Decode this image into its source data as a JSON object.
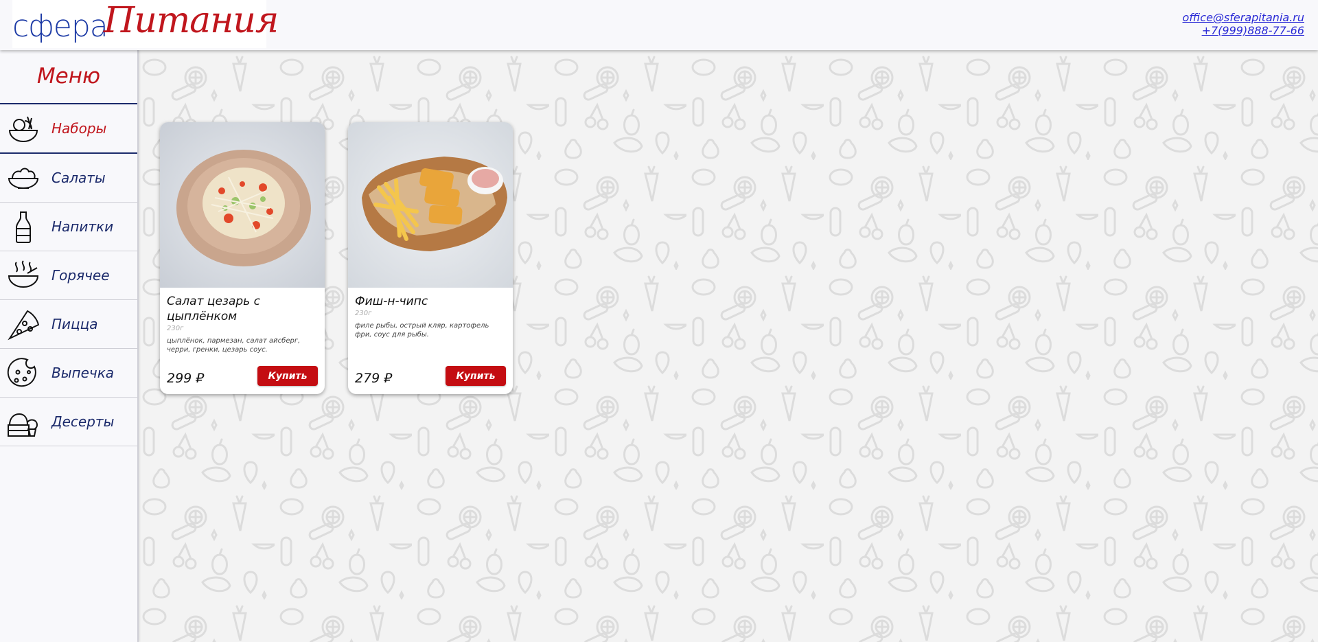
{
  "header": {
    "logo_part1": "сфера",
    "logo_part2": "Питания",
    "email": "office@sferapitania.ru",
    "phone": "+7(999)888-77-66"
  },
  "sidebar": {
    "title": "Меню",
    "items": [
      {
        "label": "Наборы",
        "icon": "food-set-icon",
        "active": true
      },
      {
        "label": "Салаты",
        "icon": "salad-bowl-icon",
        "active": false
      },
      {
        "label": "Напитки",
        "icon": "bottle-icon",
        "active": false
      },
      {
        "label": "Горячее",
        "icon": "hot-bowl-icon",
        "active": false
      },
      {
        "label": "Пицца",
        "icon": "pizza-slice-icon",
        "active": false
      },
      {
        "label": "Выпечка",
        "icon": "cookie-icon",
        "active": false
      },
      {
        "label": "Десерты",
        "icon": "dessert-icon",
        "active": false
      }
    ]
  },
  "products": [
    {
      "name": "Салат цезарь с цыплёнком",
      "weight": "230г",
      "description": "цыплёнок, пармезан, салат айсберг, черри, гренки, цезарь соус.",
      "price": "299 ₽",
      "buy_label": "Купить",
      "image": "caesar-salad-photo"
    },
    {
      "name": "Фиш-н-чипс",
      "weight": "230г",
      "description": "филе рыбы, острый кляр, картофель фри, соус для рыбы.",
      "price": "279 ₽",
      "buy_label": "Купить",
      "image": "fish-and-chips-photo"
    }
  ],
  "colors": {
    "brand_red": "#c0161d",
    "brand_blue": "#1b2a6b",
    "link_blue": "#2b2bd6",
    "buy_button": "#c40d12",
    "page_bg": "#f3f3f3"
  }
}
